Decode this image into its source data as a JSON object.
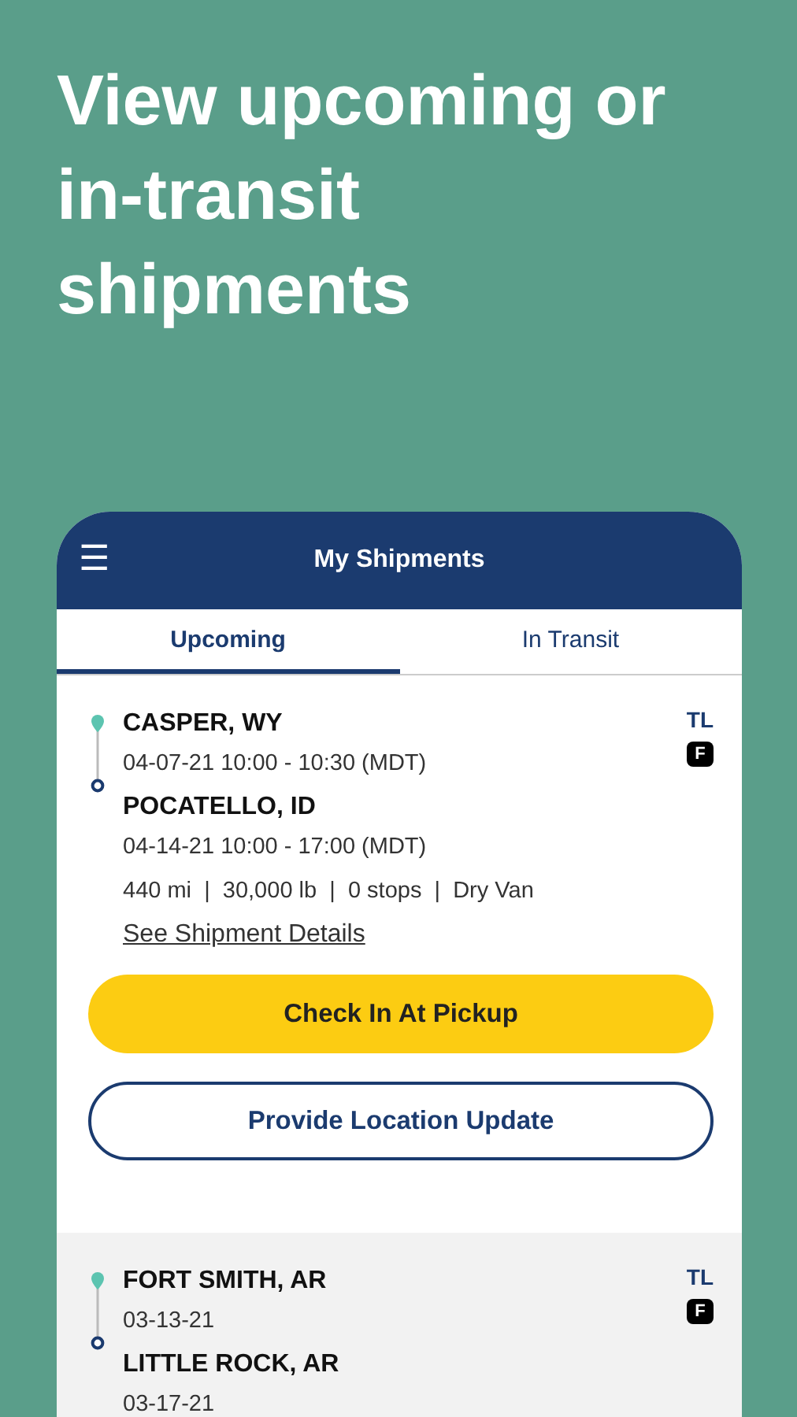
{
  "headline": "View upcoming or in-transit shipments",
  "app_bar": {
    "menu_icon": "☰",
    "title": "My Shipments"
  },
  "tabs": [
    {
      "label": "Upcoming",
      "selected": true
    },
    {
      "label": "In Transit",
      "selected": false
    }
  ],
  "shipments": [
    {
      "origin": "CASPER, WY",
      "origin_time": "04-07-21 10:00 - 10:30 (MDT)",
      "destination": "POCATELLO, ID",
      "destination_time": "04-14-21 10:00 - 17:00 (MDT)",
      "details": "440 mi  |  30,000 lb  |  0 stops  |  Dry Van",
      "link": "See Shipment Details",
      "mode": "TL",
      "badge": "F",
      "shaded": false,
      "buttons": [
        {
          "label": "Check In At Pickup",
          "kind": "primary"
        },
        {
          "label": "Provide Location Update",
          "kind": "outline"
        }
      ]
    },
    {
      "origin": "FORT SMITH, AR",
      "origin_time": "03-13-21",
      "destination": "LITTLE ROCK, AR",
      "destination_time": "03-17-21",
      "mode": "TL",
      "badge": "F",
      "shaded": true
    }
  ]
}
